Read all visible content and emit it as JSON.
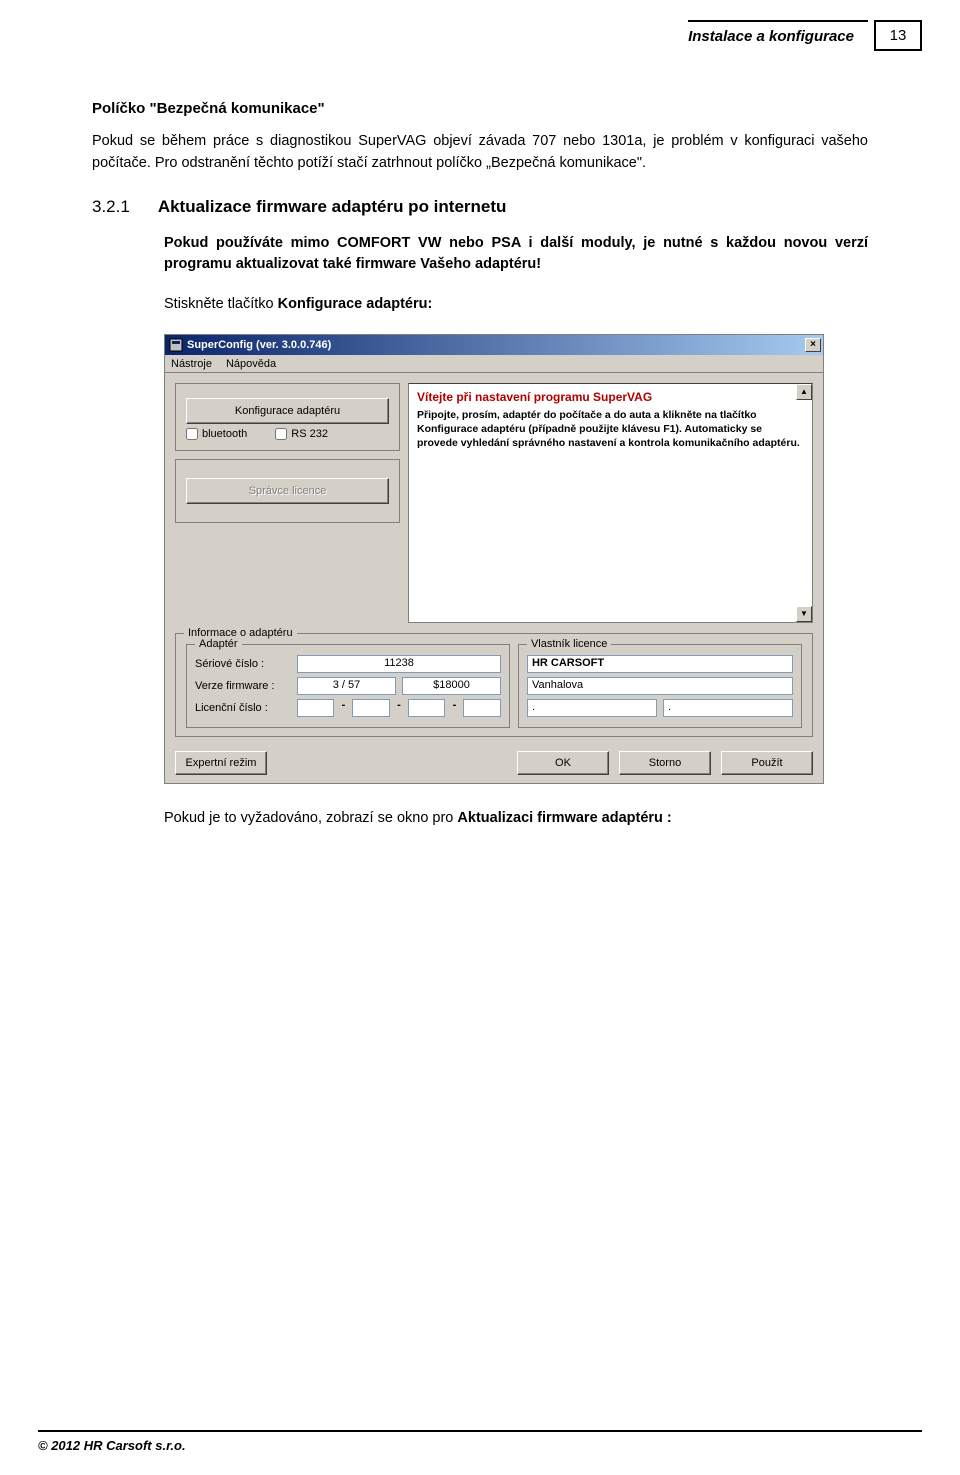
{
  "header": {
    "title": "Instalace a konfigurace",
    "page_number": "13"
  },
  "sec1": {
    "title": "Políčko \"Bezpečná komunikace\"",
    "body": "Pokud se během práce s diagnostikou SuperVAG objeví závada 707 nebo 1301a, je problém v konfiguraci vašeho počítače. Pro odstranění těchto potíží stačí zatrhnout políčko „Bezpečná komunikace\"."
  },
  "sec2": {
    "num": "3.2.1",
    "title": "Aktualizace firmware adaptéru po internetu",
    "p1_a": "Pokud používáte mimo COMFORT VW nebo PSA i další moduly, je nutné s každou novou verzí programu aktualizovat také firmware Vašeho adaptéru!",
    "p2_a": "Stiskněte tlačítko ",
    "p2_b": "Konfigurace adaptéru:"
  },
  "dialog": {
    "title": "SuperConfig (ver. 3.0.0.746)",
    "menu": {
      "tools": "Nástroje",
      "tools_u": "N",
      "help": "Nápověda",
      "help_u": "N"
    },
    "left": {
      "btn_config": "Konfigurace adaptéru",
      "cb_bt": "bluetooth",
      "cb_rs": "RS 232",
      "btn_licence": "Správce licence"
    },
    "info": {
      "welcome_title": "Vítejte při nastavení programu SuperVAG",
      "welcome_body": "Připojte, prosím, adaptér do počítače a do auta a klikněte na tlačítko Konfigurace adaptéru (případně použijte klávesu F1). Automaticky se provede vyhledání správného nastavení a kontrola komunikačního adaptéru."
    },
    "adapter_group_label": "Informace o adaptéru",
    "adapter_box_label": "Adaptér",
    "owner_box_label": "Vlastník licence",
    "adapter": {
      "serial_label": "Sériové číslo :",
      "serial_value": "11238",
      "fw_label": "Verze firmware :",
      "fw_a": "3 / 57",
      "fw_b": "$18000",
      "lic_label": "Licenční číslo :",
      "lic_a": "",
      "lic_b": "",
      "lic_c": "",
      "lic_d": ""
    },
    "owner": {
      "name": "HR CARSOFT",
      "line2": "Vanhalova",
      "d1": ".",
      "d2": "."
    },
    "buttons": {
      "expert": "Expertní režim",
      "ok": "OK",
      "cancel": "Storno",
      "apply": "Použít"
    }
  },
  "after": {
    "t1": "Pokud je to vyžadováno, zobrazí se okno pro ",
    "t2": "Aktualizaci firmware adaptéru :"
  },
  "footer": "© 2012 HR Carsoft s.r.o."
}
